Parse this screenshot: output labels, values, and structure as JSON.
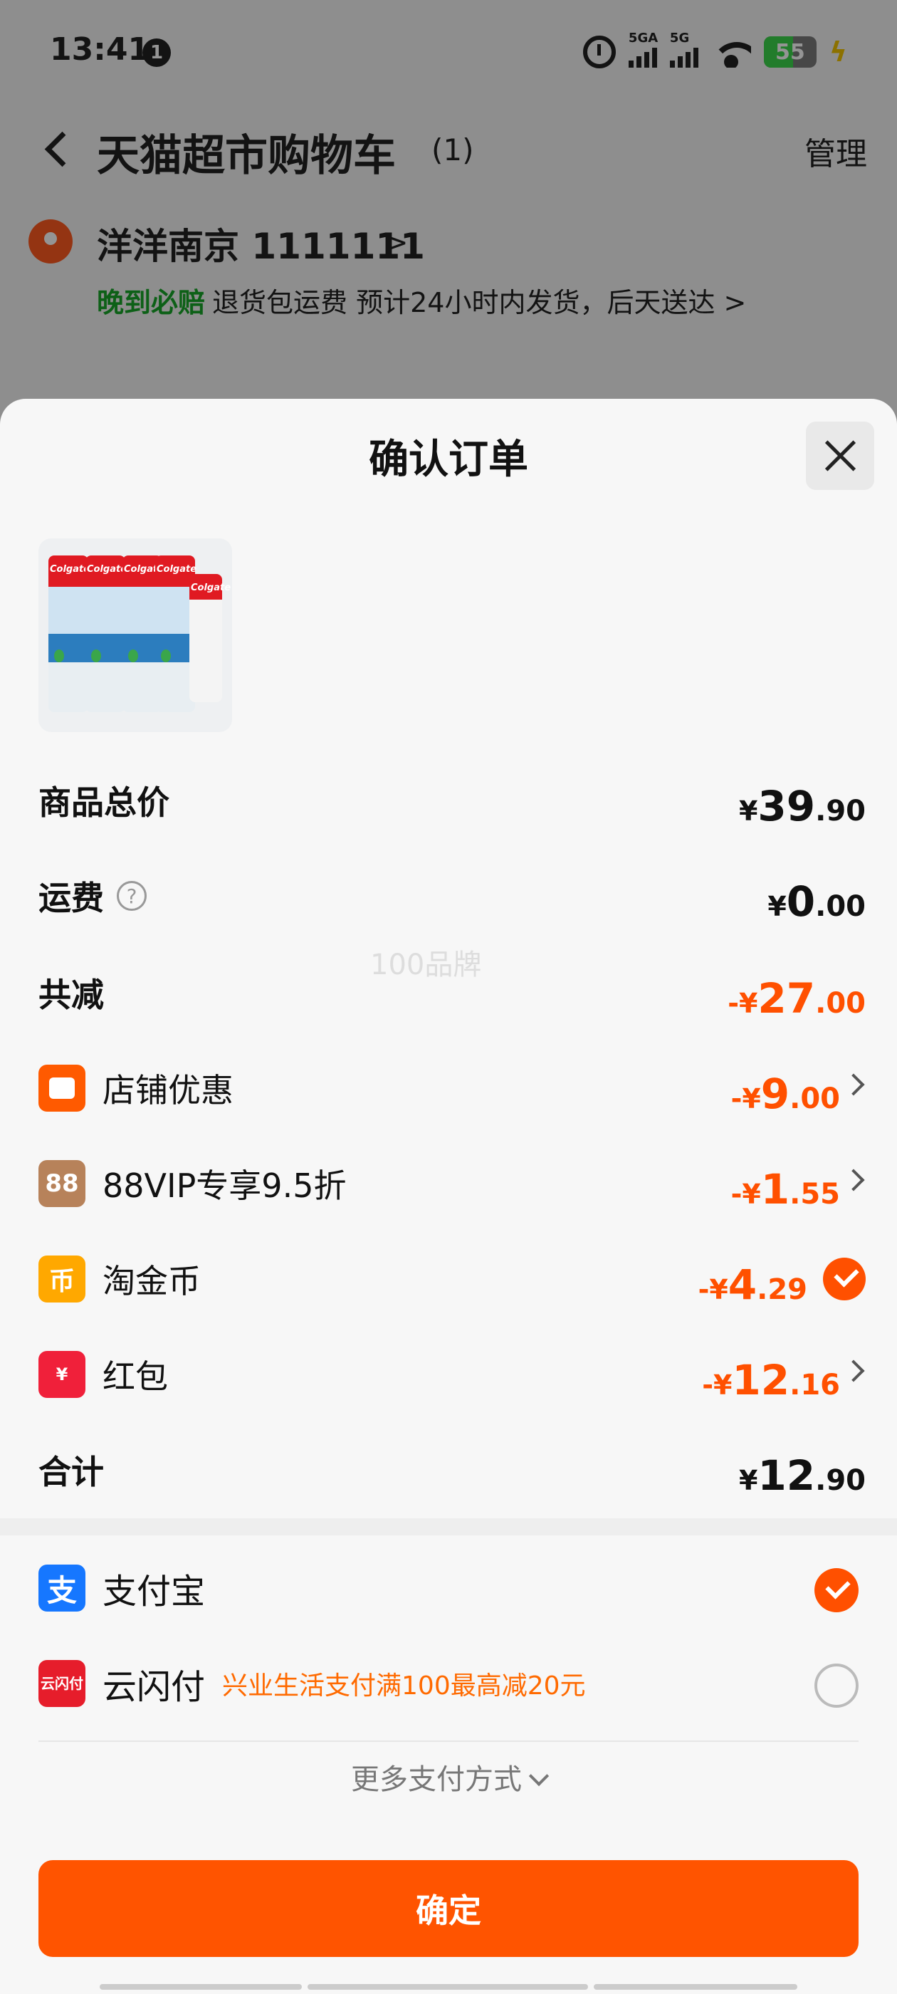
{
  "status_bar": {
    "time": "13:41",
    "notification_count": "1",
    "signal1_label": "5GA",
    "signal2_label": "5G",
    "battery_level": "55",
    "battery_fraction": 0.55
  },
  "nav": {
    "title": "天猫超市购物车",
    "count": "(1)",
    "manage": "管理"
  },
  "address": {
    "name": "洋洋南京 1111111",
    "chevron": ">",
    "badge": "晚到必赔",
    "detail": "退货包运费 预计24小时内发货，后天送达 >"
  },
  "sheet": {
    "title": "确认订单",
    "product_brand": "Colgate"
  },
  "summary": {
    "goods_total": {
      "label": "商品总价",
      "currency": "¥",
      "int": "39",
      "dec": ".90"
    },
    "shipping": {
      "label": "运费",
      "help": "?",
      "currency": "¥",
      "int": "0",
      "dec": ".00"
    },
    "watermark": "100品牌",
    "total_discount": {
      "label": "共减",
      "currency": "-¥",
      "int": "27",
      "dec": ".00"
    },
    "discounts": [
      {
        "label": "店铺优惠",
        "icon": "shop-icon",
        "currency": "-¥",
        "int": "9",
        "dec": ".00"
      },
      {
        "label": "88VIP专享9.5折",
        "icon": "vip-icon",
        "icon_text": "88",
        "currency": "-¥",
        "int": "1",
        "dec": ".55"
      },
      {
        "label": "淘金币",
        "icon": "coin-icon",
        "icon_text": "币",
        "currency": "-¥",
        "int": "4",
        "dec": ".29",
        "checked": true
      },
      {
        "label": "红包",
        "icon": "red-packet-icon",
        "icon_text": "¥",
        "currency": "-¥",
        "int": "12",
        "dec": ".16"
      }
    ],
    "grand_total": {
      "label": "合计",
      "currency": "¥",
      "int": "12",
      "dec": ".90"
    }
  },
  "payment": {
    "methods": [
      {
        "label": "支付宝",
        "icon": "alipay-icon",
        "icon_text": "支",
        "selected": true
      },
      {
        "label": "云闪付",
        "icon": "unionpay-icon",
        "icon_text": "云闪付",
        "promo": "兴业生活支付满100最高减20元",
        "selected": false
      }
    ],
    "more": "更多支付方式"
  },
  "confirm_button": "确定",
  "colors": {
    "accent": "#ff5400",
    "discount": "#ff5000",
    "green": "#18a628"
  }
}
